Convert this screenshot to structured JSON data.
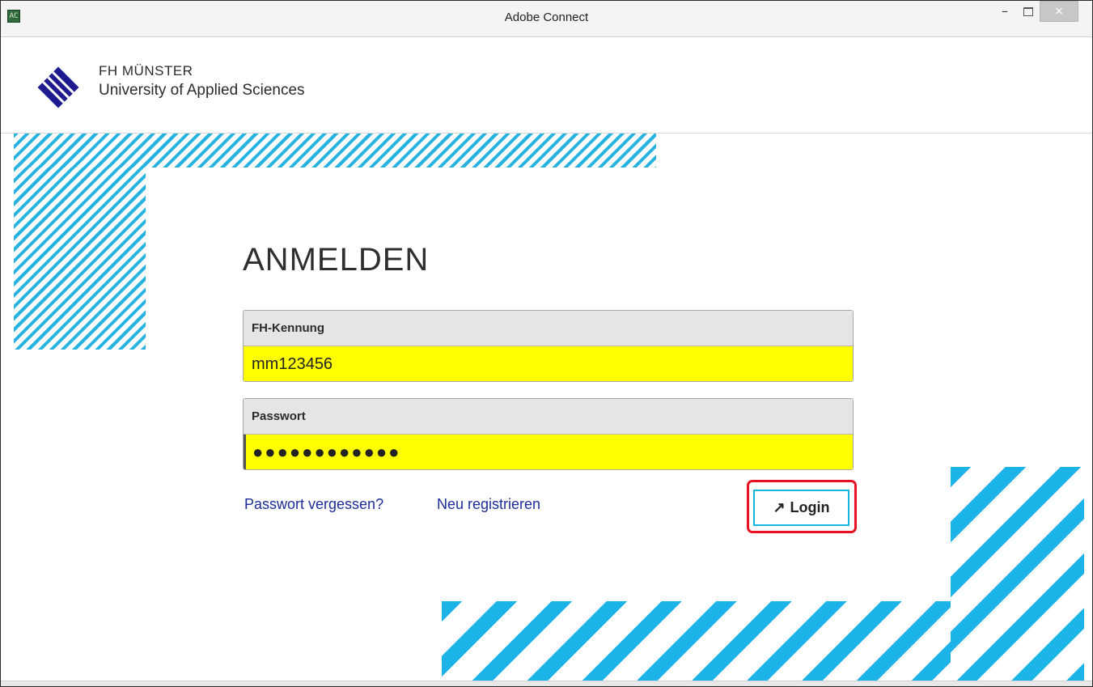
{
  "window": {
    "title": "Adobe Connect",
    "app_icon_glyph": "AC",
    "controls": {
      "minimize": "–",
      "close": "×"
    }
  },
  "brand": {
    "name": "FH MÜNSTER",
    "subtitle": "University of Applied Sciences",
    "logo_icon": "fh-muenster-logo",
    "logo_color": "#1e1b8f"
  },
  "login": {
    "heading": "ANMELDEN",
    "username_label": "FH-Kennung",
    "username_value": "mm123456",
    "password_label": "Passwort",
    "password_value": "●●●●●●●●●●●●",
    "forgot_link": "Passwort vergessen?",
    "register_link": "Neu registrieren",
    "login_button": "Login",
    "login_icon": "arrow-up-right-icon"
  },
  "colors": {
    "stripe": "#1cb4e8",
    "field_highlight": "#ffff00",
    "link": "#1c2c9a",
    "annotation": "#e81123"
  }
}
